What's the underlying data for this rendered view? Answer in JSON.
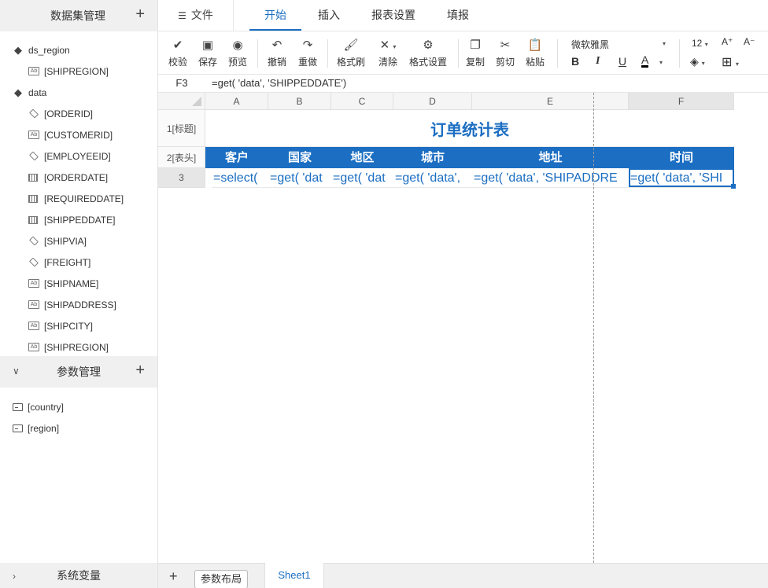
{
  "dataset_panel": {
    "title": "数据集管理",
    "datasets": [
      {
        "name": "ds_region",
        "fields": [
          {
            "name": "[SHIPREGION]",
            "type": "text"
          }
        ]
      },
      {
        "name": "data",
        "fields": [
          {
            "name": "[ORDERID]",
            "type": "number"
          },
          {
            "name": "[CUSTOMERID]",
            "type": "text"
          },
          {
            "name": "[EMPLOYEEID]",
            "type": "number"
          },
          {
            "name": "[ORDERDATE]",
            "type": "date"
          },
          {
            "name": "[REQUIREDDATE]",
            "type": "date"
          },
          {
            "name": "[SHIPPEDDATE]",
            "type": "date"
          },
          {
            "name": "[SHIPVIA]",
            "type": "number"
          },
          {
            "name": "[FREIGHT]",
            "type": "number"
          },
          {
            "name": "[SHIPNAME]",
            "type": "text"
          },
          {
            "name": "[SHIPADDRESS]",
            "type": "text"
          },
          {
            "name": "[SHIPCITY]",
            "type": "text"
          },
          {
            "name": "[SHIPREGION]",
            "type": "text"
          }
        ]
      }
    ]
  },
  "param_panel": {
    "title": "参数管理",
    "params": [
      "[country]",
      "[region]"
    ]
  },
  "sys_panel": {
    "title": "系统变量"
  },
  "top_tabs": {
    "file": "文件",
    "items": [
      "开始",
      "插入",
      "报表设置",
      "填报"
    ],
    "active": "开始"
  },
  "ribbon": {
    "buttons": [
      "校验",
      "保存",
      "预览",
      "撤销",
      "重做",
      "格式刷",
      "清除",
      "格式设置",
      "复制",
      "剪切",
      "粘贴"
    ],
    "font_name": "微软雅黑",
    "font_size": "12",
    "format_glyphs": {
      "bold": "B",
      "italic": "I",
      "underline": "U",
      "font_color": "A",
      "grow": "A⁺",
      "shrink": "A⁻"
    }
  },
  "formula_bar": {
    "cell_ref": "F3",
    "formula": "=get( 'data', 'SHIPPEDDATE')"
  },
  "sheet": {
    "columns": [
      "A",
      "B",
      "C",
      "D",
      "E",
      "F"
    ],
    "rows": [
      "1[标题]",
      "2[表头]",
      "3"
    ],
    "title": "订单统计表",
    "headers": [
      "客户",
      "国家",
      "地区",
      "城市",
      "地址",
      "时间"
    ],
    "cells": [
      "=select(",
      "=get( 'dat",
      "=get( 'dat",
      "=get( 'data',",
      "=get( 'data', 'SHIPADDRE",
      "=get( 'data', 'SHI"
    ]
  },
  "sheet_tabs": {
    "add": "+",
    "param_layout": "参数布局",
    "sheets": [
      "Sheet1"
    ]
  },
  "colors": {
    "accent": "#1b6ec2",
    "header_fill": "#1b6ec2"
  }
}
